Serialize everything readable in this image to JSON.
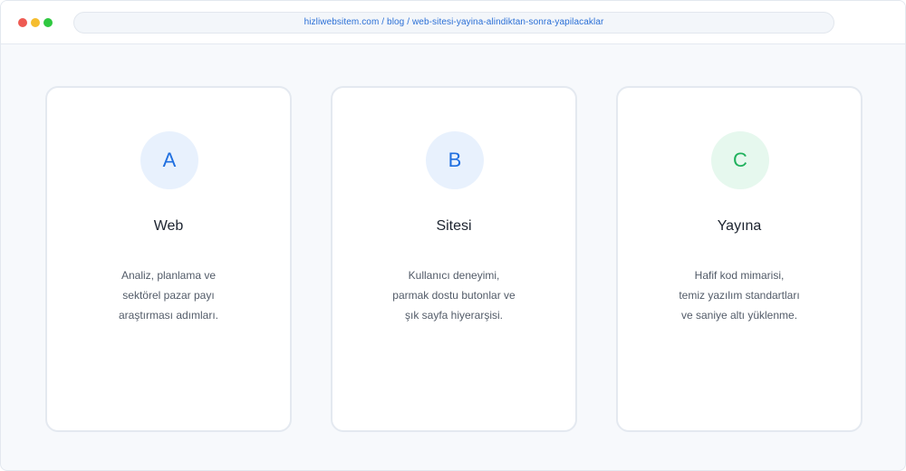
{
  "browser": {
    "url": "hizliwebsitem.com / blog / web-sitesi-yayina-alindiktan-sonra-yapilacaklar"
  },
  "cards": [
    {
      "badge": "A",
      "title": "Web",
      "lines": [
        "Analiz, planlama ve",
        "sektörel pazar payı",
        "araştırması adımları."
      ]
    },
    {
      "badge": "B",
      "title": "Sitesi",
      "lines": [
        "Kullanıcı deneyimi,",
        "parmak dostu butonlar ve",
        "şık sayfa hiyerarşisi."
      ]
    },
    {
      "badge": "C",
      "title": "Yayına",
      "lines": [
        "Hafif kod mimarisi,",
        "temiz yazılım standartları",
        "ve saniye altı yüklenme."
      ]
    }
  ],
  "colors": {
    "accent_blue": "#1f6fe0",
    "accent_green": "#1fb15c"
  }
}
